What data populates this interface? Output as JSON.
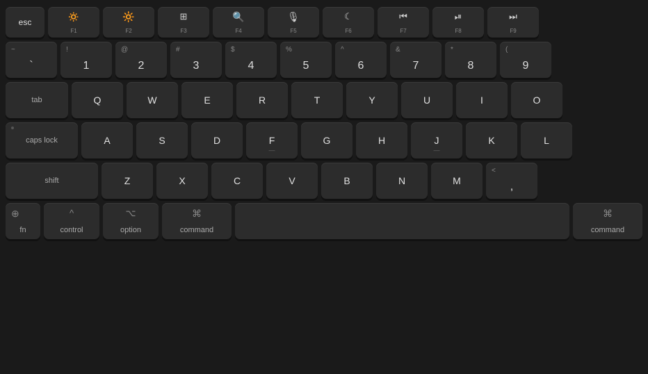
{
  "keyboard": {
    "rows": {
      "function": [
        {
          "id": "esc",
          "label": "esc",
          "width": "esc"
        },
        {
          "id": "f1",
          "icon": "☀",
          "fnLabel": "F1",
          "width": "f"
        },
        {
          "id": "f2",
          "icon": "☀",
          "fnLabel": "F2",
          "width": "f"
        },
        {
          "id": "f3",
          "icon": "⊞",
          "fnLabel": "F3",
          "width": "f"
        },
        {
          "id": "f4",
          "icon": "⌕",
          "fnLabel": "F4",
          "width": "f"
        },
        {
          "id": "f5",
          "icon": "🎙",
          "fnLabel": "F5",
          "width": "f"
        },
        {
          "id": "f6",
          "icon": "☾",
          "fnLabel": "F6",
          "width": "f"
        },
        {
          "id": "f7",
          "icon": "⏮",
          "fnLabel": "F7",
          "width": "f"
        },
        {
          "id": "f8",
          "icon": "⏯",
          "fnLabel": "F8",
          "width": "f"
        },
        {
          "id": "f9",
          "icon": "⏭",
          "fnLabel": "F9",
          "width": "f"
        }
      ],
      "number": [
        {
          "id": "tilde",
          "symbol": "~",
          "label": "`",
          "width": "std"
        },
        {
          "id": "1",
          "symbol": "!",
          "label": "1",
          "width": "std"
        },
        {
          "id": "2",
          "symbol": "@",
          "label": "2",
          "width": "std"
        },
        {
          "id": "3",
          "symbol": "#",
          "label": "3",
          "width": "std"
        },
        {
          "id": "4",
          "symbol": "$",
          "label": "4",
          "width": "std"
        },
        {
          "id": "5",
          "symbol": "%",
          "label": "5",
          "width": "std"
        },
        {
          "id": "6",
          "symbol": "^",
          "label": "6",
          "width": "std"
        },
        {
          "id": "7",
          "symbol": "&",
          "label": "7",
          "width": "std"
        },
        {
          "id": "8",
          "symbol": "*",
          "label": "8",
          "width": "std"
        },
        {
          "id": "9",
          "symbol": "(",
          "label": "9",
          "width": "std"
        }
      ],
      "qwerty": [
        "Q",
        "W",
        "E",
        "R",
        "T",
        "Y",
        "U",
        "I",
        "O"
      ],
      "asdf": [
        "A",
        "S",
        "D",
        "F",
        "G",
        "H",
        "J",
        "K",
        "L"
      ],
      "zxcv": [
        "Z",
        "X",
        "C",
        "V",
        "B",
        "N",
        "M"
      ]
    },
    "modifiers": {
      "tab": "tab",
      "caps": "caps lock",
      "shift_left": "shift",
      "shift_right": "<\n,",
      "fn": "fn",
      "globe": "⊕",
      "control": "control",
      "option": "option",
      "command_left": "command",
      "command_right": "command",
      "ctrl_symbol": "^",
      "opt_symbol": "⌥",
      "cmd_symbol": "⌘"
    }
  }
}
